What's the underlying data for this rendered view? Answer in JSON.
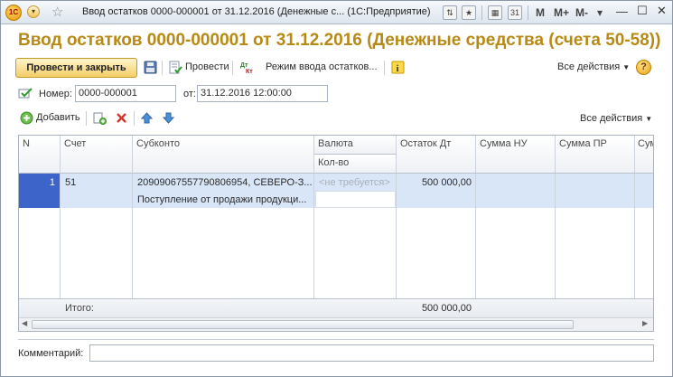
{
  "window": {
    "title": "Ввод остатков 0000-000001 от 31.12.2016 (Денежные с...  (1С:Предприятие)",
    "logo_text": "1С",
    "memory_buttons": [
      "M",
      "M+",
      "M-"
    ]
  },
  "header": {
    "title": "Ввод остатков 0000-000001 от 31.12.2016 (Денежные средства (счета 50-58))"
  },
  "toolbar": {
    "post_and_close": "Провести и закрыть",
    "post": "Провести",
    "mode": "Режим ввода остатков...",
    "all_actions": "Все действия",
    "help": "?"
  },
  "fields": {
    "number_label": "Номер:",
    "number_value": "0000-000001",
    "date_label": "от:",
    "date_value": "31.12.2016 12:00:00"
  },
  "table_toolbar": {
    "add": "Добавить",
    "all_actions": "Все действия"
  },
  "table": {
    "columns": {
      "n": "N",
      "account": "Счет",
      "subconto": "Субконто",
      "currency": "Валюта",
      "quantity": "Кол-во",
      "balance_dt": "Остаток Дт",
      "sum_nu": "Сумма НУ",
      "sum_pr": "Сумма ПР",
      "sum_vr": "Сум"
    },
    "rows": [
      {
        "n": "1",
        "account": "51",
        "subconto_line1": "20909067557790806954, СЕВЕРО-З...",
        "subconto_line2": "Поступление от продажи продукци...",
        "currency": "<не требуется>",
        "balance_dt": "500 000,00"
      }
    ],
    "footer": {
      "label": "Итого:",
      "balance_dt": "500 000,00"
    }
  },
  "comment": {
    "label": "Комментарий:",
    "value": ""
  },
  "colors": {
    "title": "#b88a15",
    "selected_row": "#d8e6f7",
    "selected_cell": "#3d64c8"
  }
}
